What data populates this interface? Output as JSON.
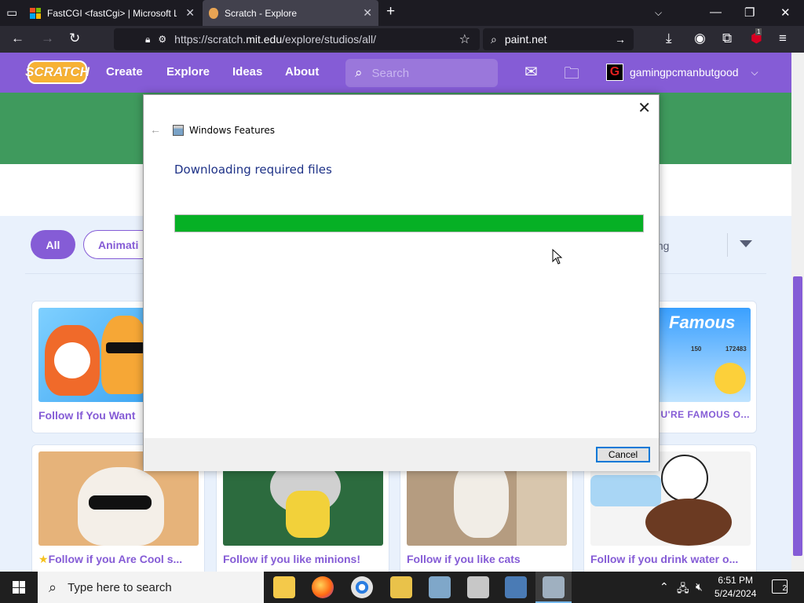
{
  "browser": {
    "tabs": [
      {
        "label": "FastCGI <fastCgi> | Microsoft Le",
        "icon": "microsoft-icon"
      },
      {
        "label": "Scratch - Explore",
        "icon": "scratch-icon",
        "active": true
      }
    ],
    "url_prefix": "https://scratch.",
    "url_domain": "mit.edu",
    "url_suffix": "/explore/studios/all/",
    "search_value": "paint.net",
    "extension_badge": "1"
  },
  "scratch": {
    "logo": "SCRATCH",
    "nav": [
      "Create",
      "Explore",
      "Ideas",
      "About"
    ],
    "search_placeholder": "Search",
    "username": "gamingpcmanbutgood",
    "avatar_letter": "G",
    "filters": {
      "all": "All",
      "animations": "Animati"
    },
    "sort_label": "ding",
    "cards": [
      {
        "title": "Follow If You Want"
      },
      {
        "title": "U'RE FAMOUS O..."
      },
      {
        "title": "Follow if you Are Cool s..."
      },
      {
        "title": "Follow if you like minions!"
      },
      {
        "title": "Follow if you like cats"
      },
      {
        "title": "Follow if you drink water o..."
      }
    ],
    "famous_thumb": {
      "heading": "Famous",
      "stat1": "150",
      "stat2": "172483"
    }
  },
  "dialog": {
    "app_title": "Windows Features",
    "heading": "Downloading required files",
    "progress_percent": 100,
    "cancel_label": "Cancel"
  },
  "taskbar": {
    "search_placeholder": "Type here to search",
    "time": "6:51 PM",
    "date": "5/24/2024",
    "notifications": "2"
  }
}
